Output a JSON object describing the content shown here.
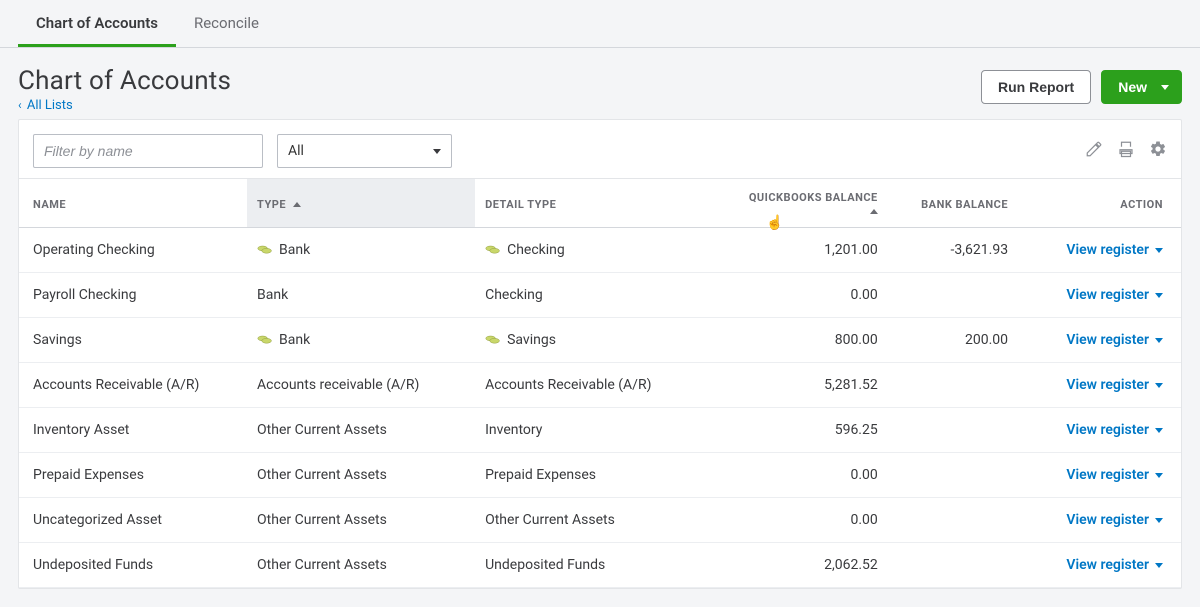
{
  "tabs": [
    {
      "label": "Chart of Accounts",
      "key": "coa"
    },
    {
      "label": "Reconcile",
      "key": "reconcile"
    }
  ],
  "active_tab": "coa",
  "page_title": "Chart of Accounts",
  "back_link": "All Lists",
  "buttons": {
    "run_report": "Run Report",
    "new": "New"
  },
  "filter": {
    "placeholder": "Filter by name",
    "value": "",
    "type_selected": "All"
  },
  "columns": {
    "name": "NAME",
    "type": "TYPE",
    "detail_type": "DETAIL TYPE",
    "qb_balance": "QUICKBOOKS BALANCE",
    "bank_balance": "BANK BALANCE",
    "action": "ACTION"
  },
  "action_label": "View register",
  "rows": [
    {
      "name": "Operating Checking",
      "type": "Bank",
      "type_icon": true,
      "detail": "Checking",
      "detail_icon": true,
      "qb": "1,201.00",
      "bank": "-3,621.93"
    },
    {
      "name": "Payroll Checking",
      "type": "Bank",
      "type_icon": false,
      "detail": "Checking",
      "detail_icon": false,
      "qb": "0.00",
      "bank": ""
    },
    {
      "name": "Savings",
      "type": "Bank",
      "type_icon": true,
      "detail": "Savings",
      "detail_icon": true,
      "qb": "800.00",
      "bank": "200.00"
    },
    {
      "name": "Accounts Receivable (A/R)",
      "type": "Accounts receivable (A/R)",
      "type_icon": false,
      "detail": "Accounts Receivable (A/R)",
      "detail_icon": false,
      "qb": "5,281.52",
      "bank": ""
    },
    {
      "name": "Inventory Asset",
      "type": "Other Current Assets",
      "type_icon": false,
      "detail": "Inventory",
      "detail_icon": false,
      "qb": "596.25",
      "bank": ""
    },
    {
      "name": "Prepaid Expenses",
      "type": "Other Current Assets",
      "type_icon": false,
      "detail": "Prepaid Expenses",
      "detail_icon": false,
      "qb": "0.00",
      "bank": ""
    },
    {
      "name": "Uncategorized Asset",
      "type": "Other Current Assets",
      "type_icon": false,
      "detail": "Other Current Assets",
      "detail_icon": false,
      "qb": "0.00",
      "bank": ""
    },
    {
      "name": "Undeposited Funds",
      "type": "Other Current Assets",
      "type_icon": false,
      "detail": "Undeposited Funds",
      "detail_icon": false,
      "qb": "2,062.52",
      "bank": ""
    }
  ]
}
